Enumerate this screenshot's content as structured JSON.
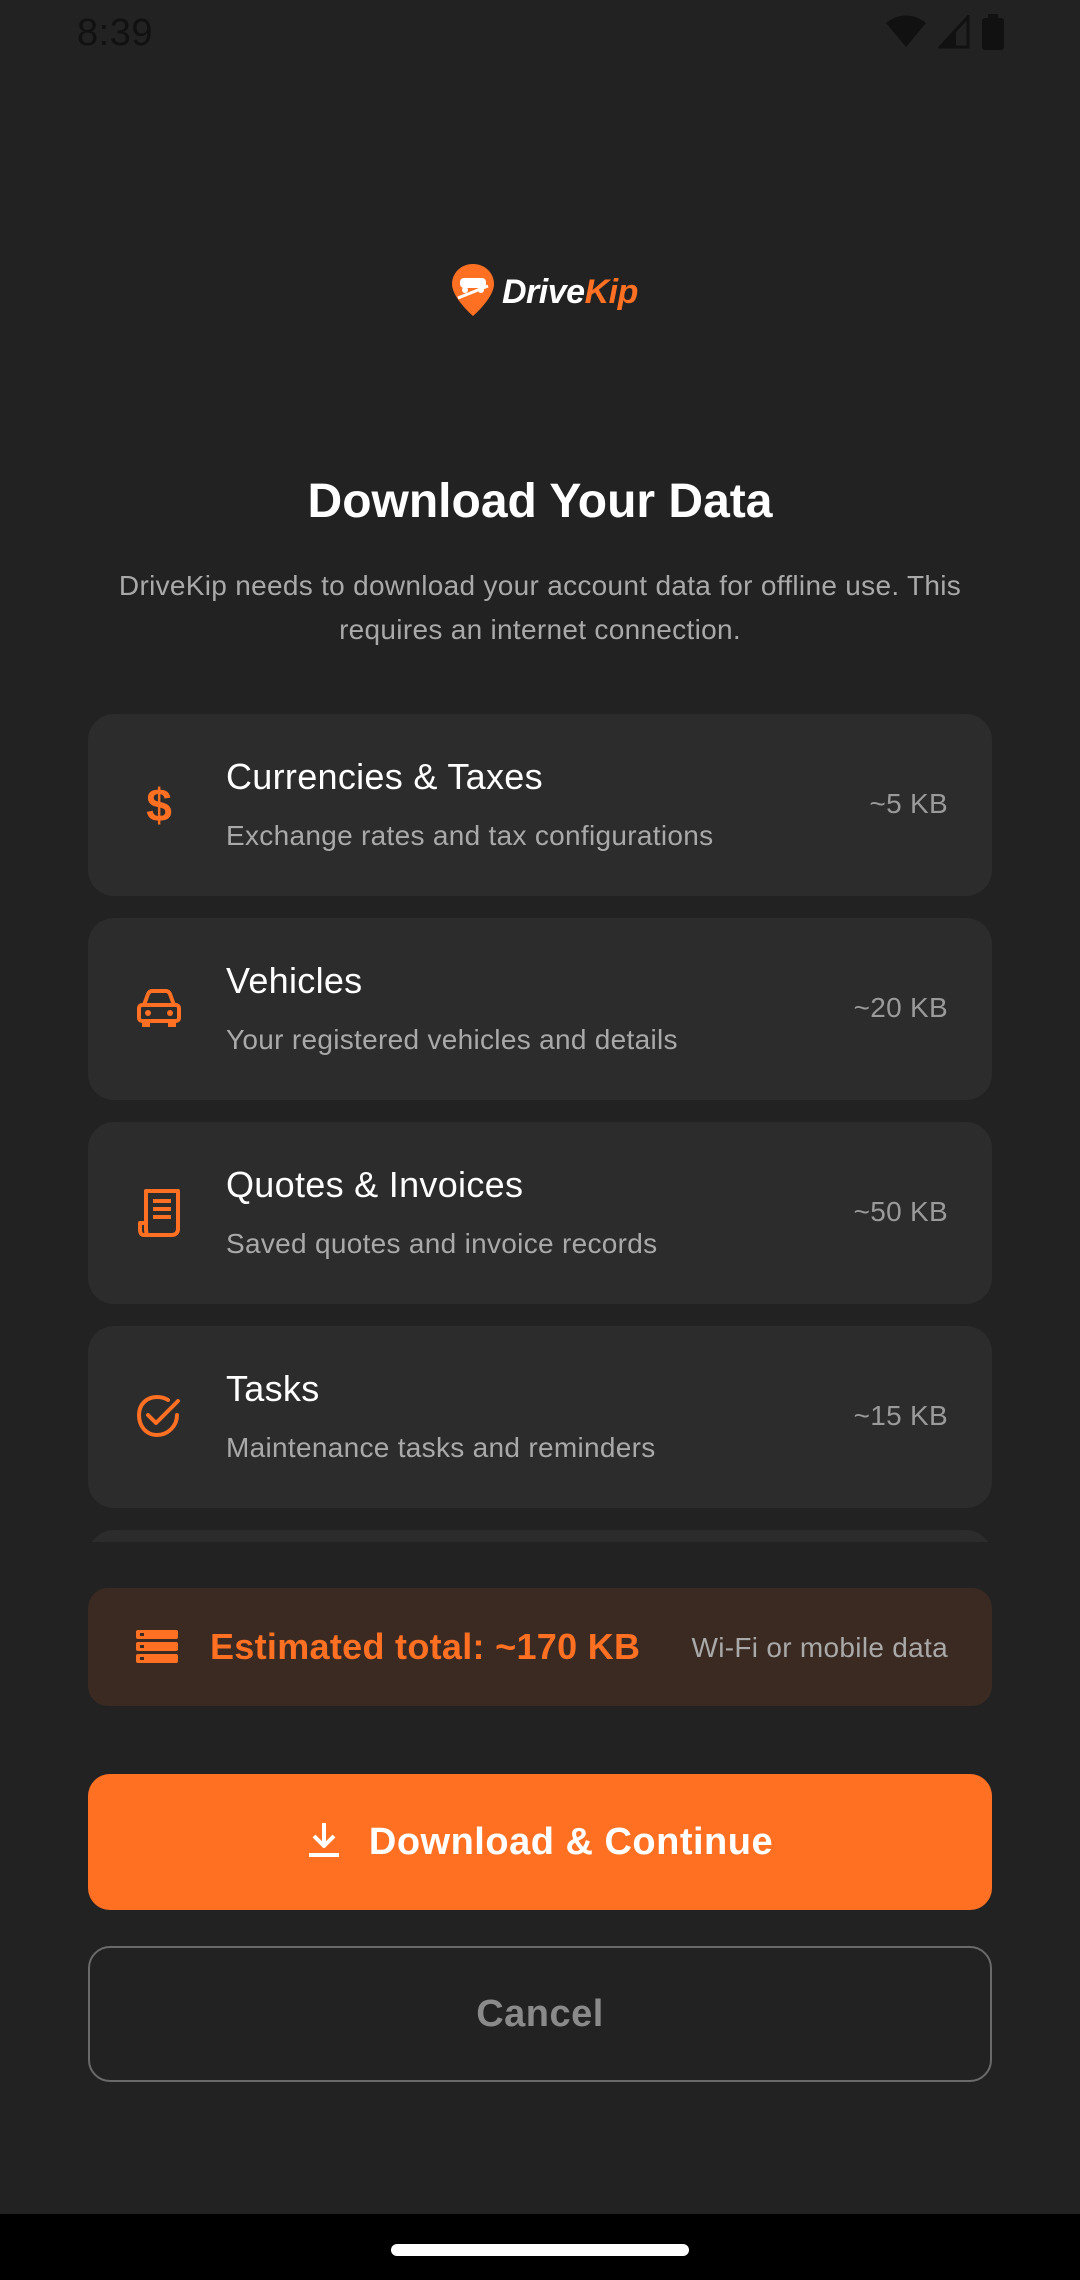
{
  "status_bar": {
    "time": "8:39",
    "icons": [
      "wifi-icon",
      "signal-icon",
      "battery-icon"
    ]
  },
  "logo": {
    "brand_part1": "Drive",
    "brand_part2": "Kip"
  },
  "header": {
    "title": "Download Your Data",
    "subtitle": "DriveKip needs to download your account data for offline use. This requires an internet connection."
  },
  "items": [
    {
      "icon": "dollar-icon",
      "title": "Currencies & Taxes",
      "description": "Exchange rates and tax configurations",
      "size": "~5 KB"
    },
    {
      "icon": "car-icon",
      "title": "Vehicles",
      "description": "Your registered vehicles and details",
      "size": "~20 KB"
    },
    {
      "icon": "receipt-icon",
      "title": "Quotes & Invoices",
      "description": "Saved quotes and invoice records",
      "size": "~50 KB"
    },
    {
      "icon": "check-circle-icon",
      "title": "Tasks",
      "description": "Maintenance tasks and reminders",
      "size": "~15 KB"
    }
  ],
  "estimate": {
    "icon": "storage-icon",
    "total_label": "Estimated total: ~170 KB",
    "network_note": "Wi-Fi or mobile data"
  },
  "actions": {
    "download_label": "Download & Continue",
    "cancel_label": "Cancel"
  },
  "colors": {
    "accent": "#ff7023",
    "background": "#222222",
    "card": "#2c2c2c",
    "estimate_bg": "#3a2a22"
  }
}
